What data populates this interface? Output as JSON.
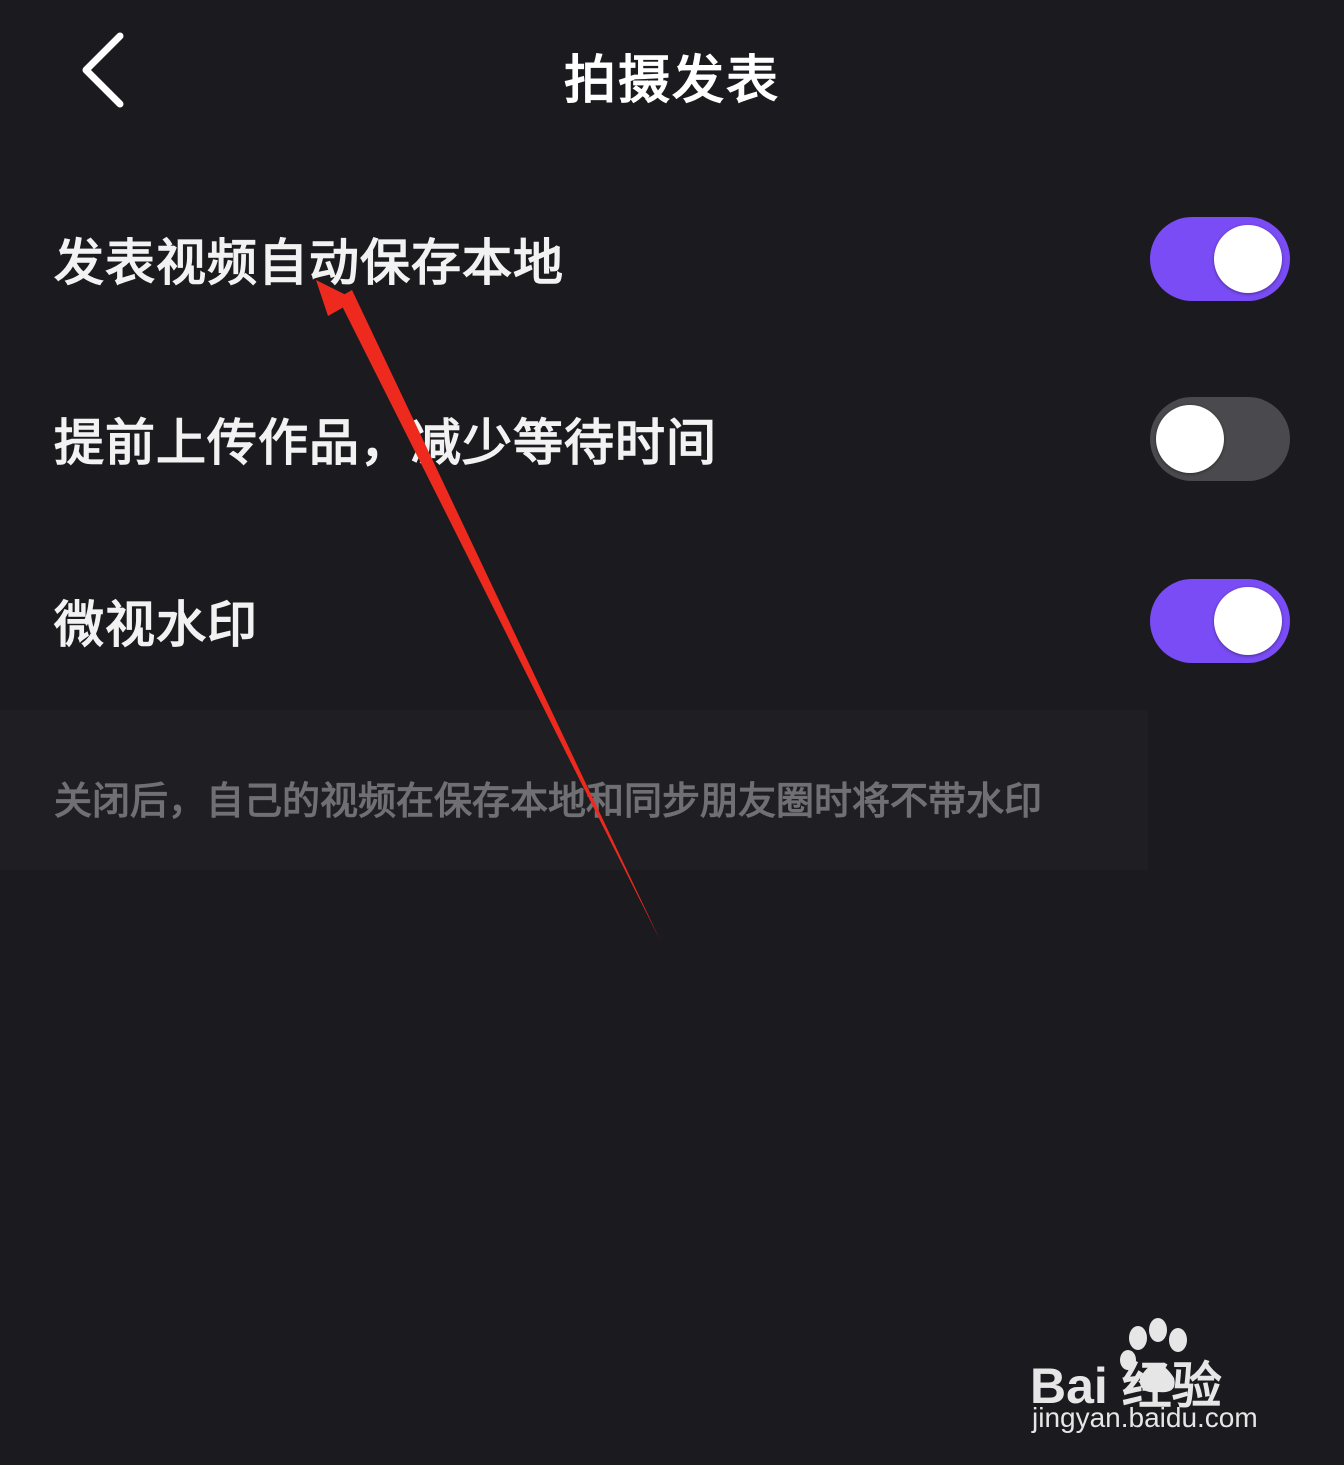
{
  "header": {
    "title": "拍摄发表",
    "back_icon": "chevron-left-icon"
  },
  "settings": [
    {
      "label": "发表视频自动保存本地",
      "enabled": true
    },
    {
      "label": "提前上传作品，减少等待时间",
      "enabled": false
    },
    {
      "label": "微视水印",
      "enabled": true
    }
  ],
  "hint": "关闭后，自己的视频在保存本地和同步朋友圈时将不带水印",
  "colors": {
    "background": "#1b1b1f",
    "toggle_on": "#7a4cf5",
    "toggle_off": "#4a4a4e",
    "annotation_arrow": "#ee2a1f"
  },
  "watermark": {
    "logo_text": "Bai 经验",
    "url": "jingyan.baidu.com"
  }
}
